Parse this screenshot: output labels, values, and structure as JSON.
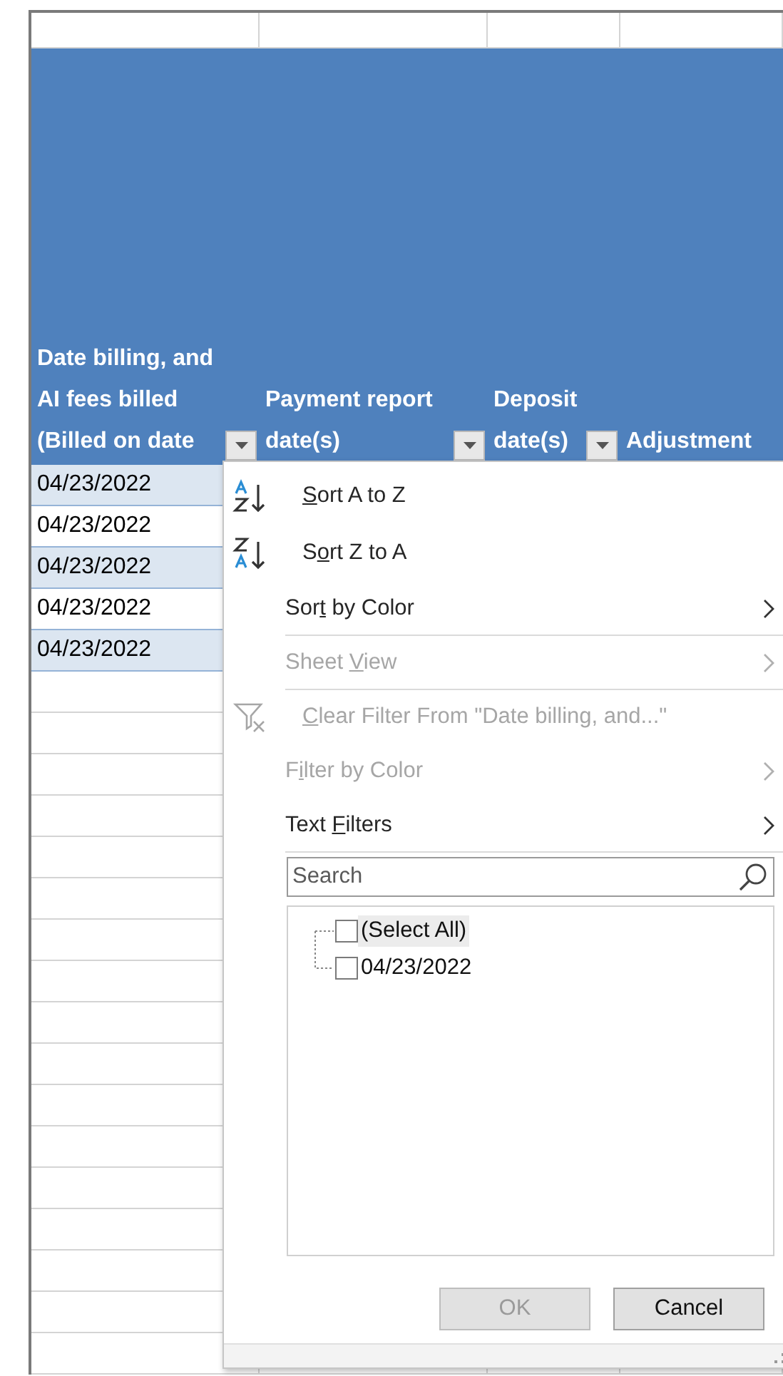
{
  "columns": [
    {
      "header_lines": [
        "Date billing, and",
        "AI fees billed",
        "(Billed on date"
      ],
      "filter_button": true
    },
    {
      "header_lines": [
        "Payment report",
        "date(s)"
      ],
      "filter_button": true
    },
    {
      "header_lines": [
        "Deposit",
        "date(s)"
      ],
      "filter_button": true
    },
    {
      "header_lines": [
        "Adjustment"
      ],
      "filter_button": false
    }
  ],
  "rows": [
    {
      "cells": [
        "04/23/2022"
      ]
    },
    {
      "cells": [
        "04/23/2022"
      ]
    },
    {
      "cells": [
        "04/23/2022"
      ]
    },
    {
      "cells": [
        "04/23/2022"
      ]
    },
    {
      "cells": [
        "04/23/2022"
      ]
    }
  ],
  "filter_menu": {
    "items": [
      {
        "kind": "sort_asc",
        "accel": "S",
        "label_post": "ort A to Z",
        "disabled": false,
        "submenu": false,
        "separator_after": false
      },
      {
        "kind": "sort_desc",
        "label_pre": "S",
        "accel": "o",
        "label_post": "rt Z to A",
        "disabled": false,
        "submenu": false,
        "separator_after": false
      },
      {
        "kind": "plain",
        "label_pre": "Sor",
        "accel": "t",
        "label_post": " by Color",
        "disabled": false,
        "submenu": true,
        "separator_after": true
      },
      {
        "kind": "plain",
        "label_pre": "Sheet ",
        "accel": "V",
        "label_post": "iew",
        "disabled": true,
        "submenu": true,
        "separator_after": true
      },
      {
        "kind": "clear",
        "accel": "C",
        "label_post": "lear Filter From \"Date billing, and...\"",
        "disabled": true,
        "submenu": false,
        "separator_after": false
      },
      {
        "kind": "plain",
        "label_pre": "F",
        "accel": "i",
        "label_post": "lter by Color",
        "disabled": true,
        "submenu": true,
        "separator_after": false
      },
      {
        "kind": "plain",
        "label_pre": "Text ",
        "accel": "F",
        "label_post": "ilters",
        "disabled": false,
        "submenu": true,
        "separator_after": true
      }
    ],
    "search": {
      "placeholder": "Search"
    },
    "values": [
      {
        "label": "(Select All)",
        "checked": false,
        "selected": true
      },
      {
        "label": "04/23/2022",
        "checked": false,
        "selected": false
      }
    ],
    "buttons": [
      {
        "label": "OK",
        "disabled": true
      },
      {
        "label": "Cancel",
        "disabled": false
      }
    ]
  }
}
